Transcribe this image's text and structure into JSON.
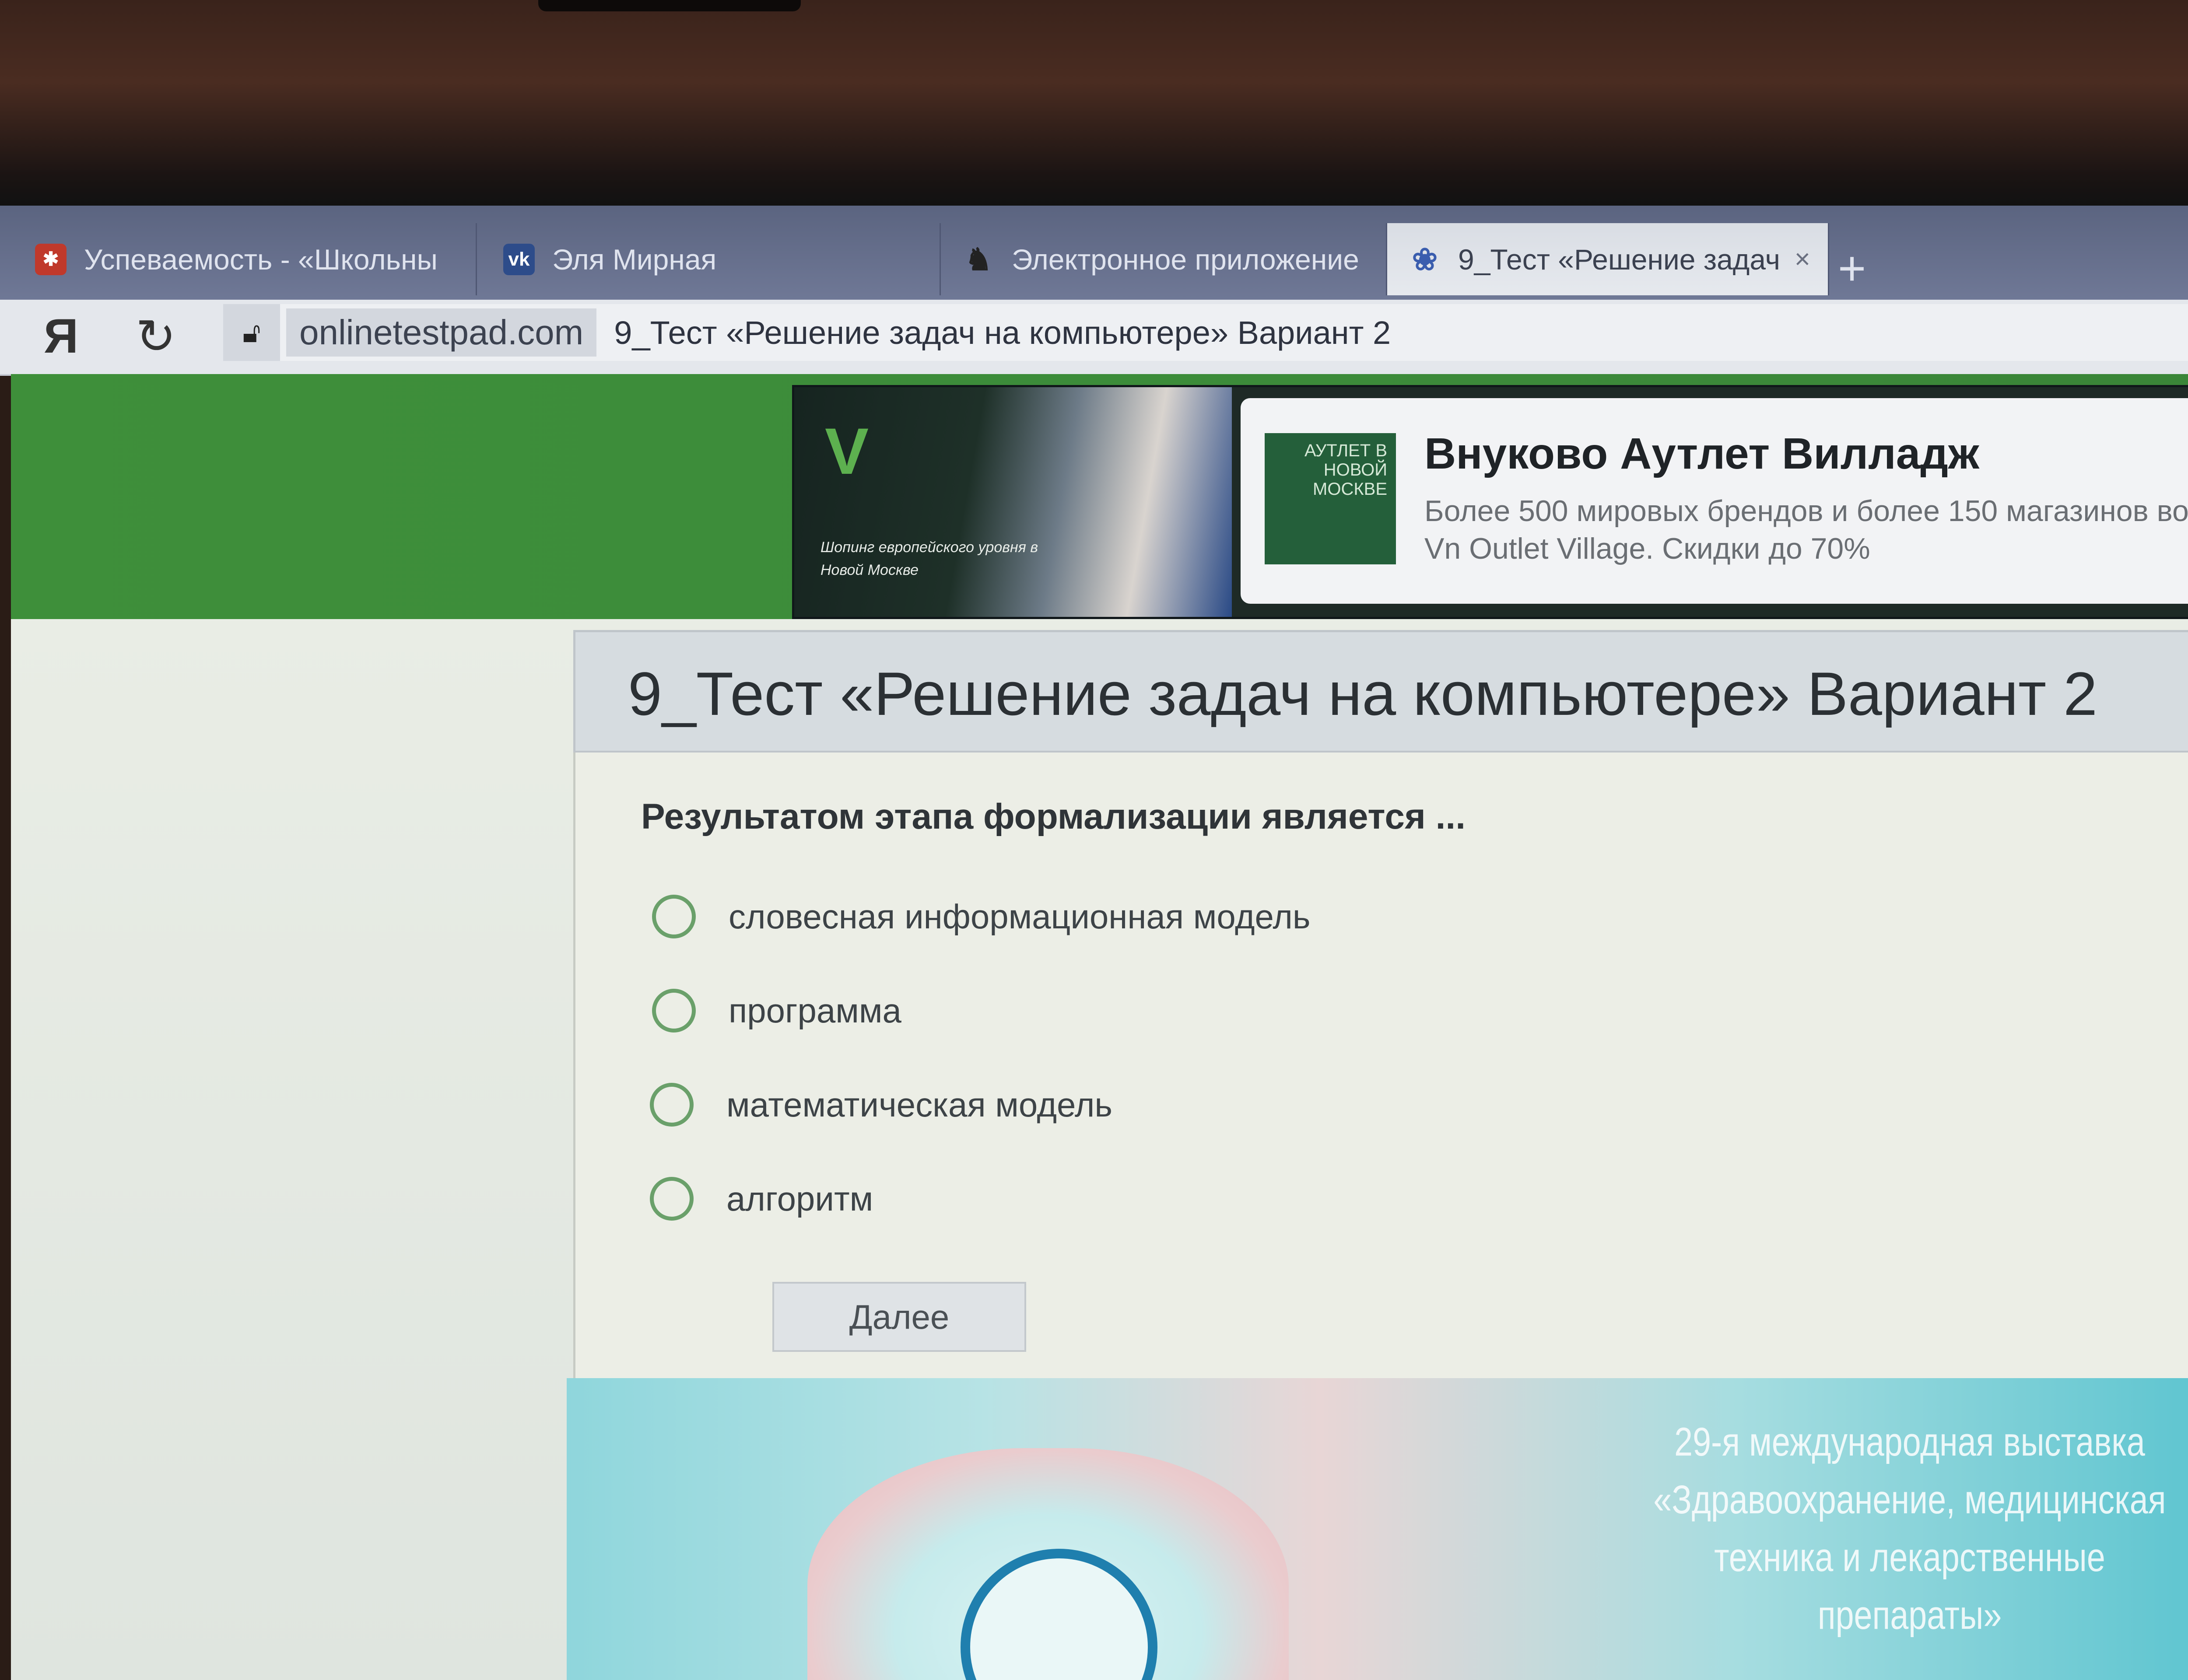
{
  "browser": {
    "tabs": [
      {
        "label": "Успеваемость - «Школьны",
        "icon": "school-icon",
        "active": false
      },
      {
        "label": "Эля Мирная",
        "icon": "vk-icon",
        "active": false
      },
      {
        "label": "Электронное приложение",
        "icon": "app-icon",
        "active": false
      },
      {
        "label": "9_Тест «Решение задач",
        "icon": "test-icon",
        "active": true
      }
    ],
    "new_tab_label": "+",
    "close_tab_label": "×",
    "yandex_button": "Я",
    "reload_label": "↻",
    "domain": "onlinetestpad.com",
    "page_title": "9_Тест «Решение задач на компьютере» Вариант 2"
  },
  "ad_banner": {
    "thumb_text": "АУТЛЕТ В НОВОЙ МОСКВЕ",
    "headline": "Внуково Аутлет Вилладж",
    "description": "Более 500 мировых брендов и более 150 магазинов во Vn Outlet Village. Скидки до 70%",
    "slogan": "Шопинг европейского уровня в Новой Москве",
    "accent_color": "#5db04f"
  },
  "test": {
    "title": "9_Тест «Решение задач на компьютере» Вариант 2",
    "question": "Результатом этапа формализации является ...",
    "options": [
      {
        "label": "словесная информационная модель",
        "selected": false
      },
      {
        "label": "программа",
        "selected": false
      },
      {
        "label": "математическая модель",
        "selected": false
      },
      {
        "label": "алгоритм",
        "selected": false
      }
    ],
    "next_button": "Далее"
  },
  "bottom_ad": {
    "text": "29-я международная выставка «Здравоохранение, медицинская техника и лекарственные препараты»"
  },
  "colors": {
    "header_green": "#3e8f3a",
    "radio_green": "#6aa06a",
    "tab_strip": "#6f7896"
  }
}
